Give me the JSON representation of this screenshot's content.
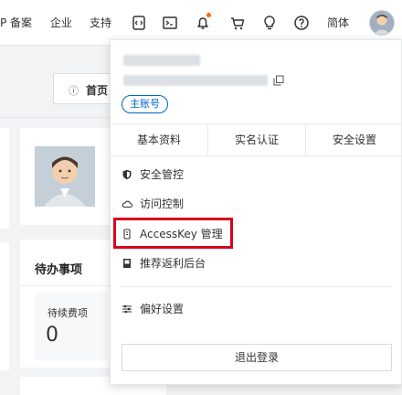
{
  "topbar": {
    "links": {
      "filing": "P 备案",
      "enterprise": "企业",
      "support": "支持",
      "language": "简体"
    },
    "icons": [
      "code-icon",
      "terminal-icon",
      "bell-icon",
      "cart-icon",
      "lightbulb-icon",
      "help-icon"
    ]
  },
  "home": {
    "icon": "ⓘ",
    "label": "首页"
  },
  "todo": {
    "title": "待办事项",
    "item_label": "待续费项",
    "item_count": "0"
  },
  "account_menu": {
    "badge": "主账号",
    "tabs": [
      "基本资料",
      "实名认证",
      "安全设置"
    ],
    "items": [
      {
        "label": "安全管控",
        "icon": "shield-icon"
      },
      {
        "label": "访问控制",
        "icon": "cloud-icon"
      },
      {
        "label": "AccessKey 管理",
        "icon": "key-icon"
      },
      {
        "label": "推荐返利后台",
        "icon": "book-icon"
      },
      {
        "label": "偏好设置",
        "icon": "sliders-icon"
      }
    ],
    "logout": "退出登录"
  },
  "colors": {
    "accent": "#0064c8",
    "highlight": "#d9001b",
    "notify": "#ff6a00"
  }
}
